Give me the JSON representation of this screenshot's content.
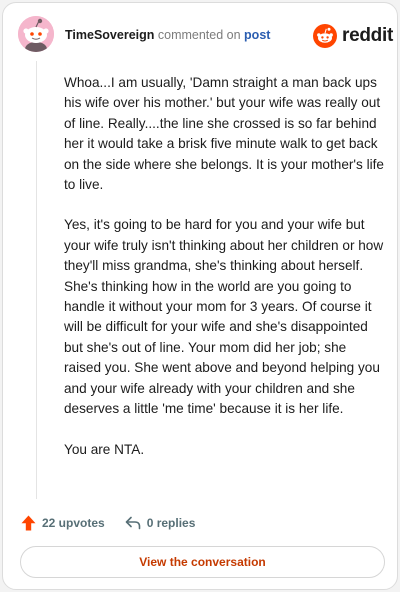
{
  "header": {
    "username": "TimeSovereign",
    "action_text": "commented on",
    "post_link": "post",
    "logo_text": "reddit",
    "avatar_icon": "snoo-avatar-icon",
    "logo_icon": "reddit-snoo-icon"
  },
  "comment": {
    "paragraphs": [
      "Whoa...I am usually, 'Damn straight a man back ups his wife over his mother.' but your wife was really out of line. Really....the line she crossed is so far behind her it would take a brisk five minute walk to get back on the side where she belongs. It is your mother's life to live.",
      "Yes, it's going to be hard for you and your wife but your wife truly isn't thinking about her children or how they'll miss grandma, she's thinking about herself. She's thinking how in the world are you going to handle it without your mom for 3 years. Of course it will be difficult for your wife and she's disappointed but she's out of line. Your mom did her job; she raised you. She went above and beyond helping you and your wife already with your children and she deserves a little 'me time' because it is her life.",
      "You are NTA."
    ]
  },
  "footer": {
    "upvotes_label": "22 upvotes",
    "replies_label": "0 replies",
    "upvote_icon": "upvote-arrow-icon",
    "reply_icon": "reply-arrow-icon",
    "view_button_label": "View the conversation"
  },
  "colors": {
    "accent_orange": "#ff4500",
    "link_blue": "#2a5db0",
    "button_text": "#c53a00",
    "avatar_bg": "#f5b6cc"
  }
}
